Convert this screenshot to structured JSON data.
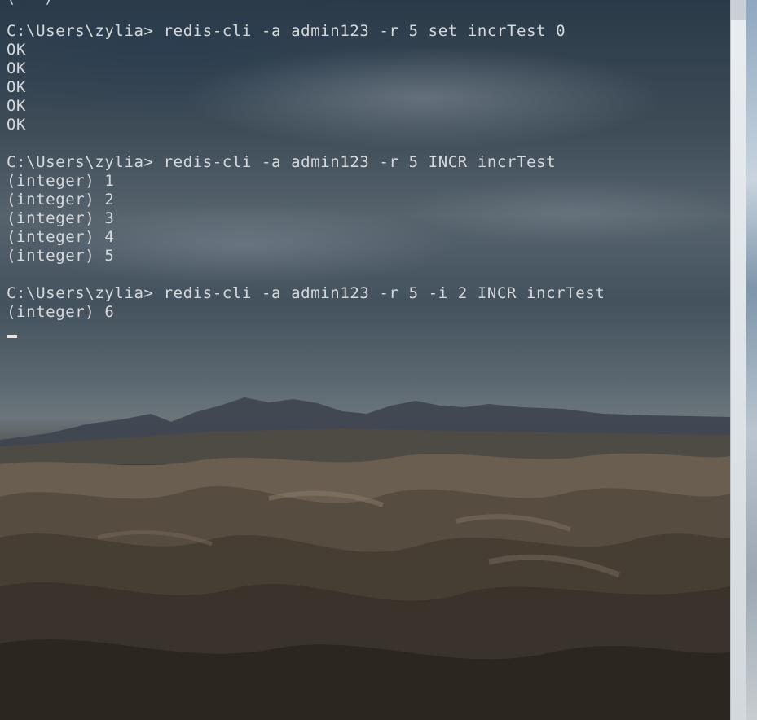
{
  "console": {
    "blocks": [
      {
        "prompt": "C:\\Users\\zylia> ",
        "command": "redis-cli -a admin123 -r 5 set incrTest 0",
        "output": [
          "OK",
          "OK",
          "OK",
          "OK",
          "OK"
        ]
      },
      {
        "prompt": "C:\\Users\\zylia> ",
        "command": "redis-cli -a admin123 -r 5 INCR incrTest",
        "output": [
          "(integer) 1",
          "(integer) 2",
          "(integer) 3",
          "(integer) 4",
          "(integer) 5"
        ]
      },
      {
        "prompt": "C:\\Users\\zylia> ",
        "command": "redis-cli -a admin123 -r 5 -i 2 INCR incrTest",
        "output": [
          "(integer) 6"
        ]
      }
    ]
  },
  "colors": {
    "text": "#d6d9dc",
    "cursor": "#e6e6e6"
  }
}
